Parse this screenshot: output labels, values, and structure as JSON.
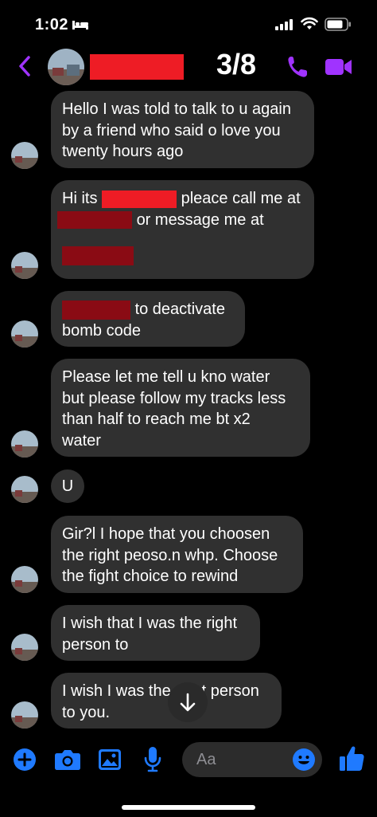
{
  "status_bar": {
    "time": "1:02"
  },
  "header": {
    "counter": "3/8"
  },
  "messages": [
    {
      "lines": [
        "Hello I was told to talk to u again",
        "by a friend who said o love you",
        "twenty hours ago"
      ]
    },
    {
      "line1_prefix": "Hi its",
      "line1_suffix": "pleace call me at",
      "line2_suffix": "or message me at"
    },
    {
      "line1_suffix": "to deactivate",
      "line2": "bomb code"
    },
    {
      "lines": [
        "Please let me tell u kno water",
        "but please follow my tracks less",
        "than half to reach me bt x2",
        "water"
      ]
    },
    {
      "lines": [
        "U"
      ]
    },
    {
      "lines": [
        "Gir?l I hope that you choosen",
        "the right peoso.n whp. Choose",
        "the fight choice to rewind"
      ]
    },
    {
      "lines": [
        "I wish that I was the right",
        "person to"
      ]
    },
    {
      "lines": [
        "I wish I was the right person",
        "to you."
      ]
    }
  ],
  "composer": {
    "placeholder": "Aa"
  },
  "colors": {
    "accent": "#a033ff",
    "composer_blue": "#1f7aff",
    "bubble": "#303030",
    "redact_red": "#ee1c25",
    "redact_dark": "#8a0b14"
  }
}
